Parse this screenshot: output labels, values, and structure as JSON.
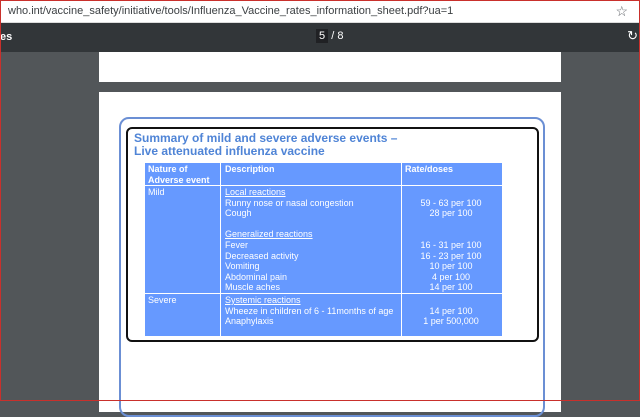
{
  "browser": {
    "url": "who.int/vaccine_safety/initiative/tools/Influenza_Vaccine_rates_information_sheet.pdf?ua=1",
    "bookmark_icon": "star-icon"
  },
  "pdf_toolbar": {
    "title_fragment": "es",
    "page_current": "5",
    "page_separator": "/",
    "page_total": "8",
    "rotate_icon": "refresh-icon"
  },
  "summary": {
    "title_line1": "Summary of mild and severe adverse events –",
    "title_line2": "Live attenuated influenza vaccine",
    "headers": {
      "nature_line1": "Nature of",
      "nature_line2": "Adverse event",
      "description": "Description",
      "rate": "Rate/doses"
    },
    "mild": {
      "label": "Mild",
      "local_heading": "Local reactions",
      "local": [
        {
          "desc": "Runny nose or nasal congestion",
          "rate": "59 - 63 per 100"
        },
        {
          "desc": "Cough",
          "rate": "28 per 100"
        }
      ],
      "general_heading": "Generalized reactions",
      "general": [
        {
          "desc": "Fever",
          "rate": "16 - 31 per 100"
        },
        {
          "desc": "Decreased activity",
          "rate": "16 - 23 per 100"
        },
        {
          "desc": "Vomiting",
          "rate": "10 per 100"
        },
        {
          "desc": "Abdominal pain",
          "rate": "4 per 100"
        },
        {
          "desc": "Muscle aches",
          "rate": "14 per 100"
        }
      ]
    },
    "severe": {
      "label": "Severe",
      "systemic_heading": "Systemic reactions",
      "items": [
        {
          "desc": "Wheeze in children of 6 - 11months of age",
          "rate": "14 per 100"
        },
        {
          "desc": "Anaphylaxis",
          "rate": "1 per 500,000"
        }
      ]
    }
  }
}
